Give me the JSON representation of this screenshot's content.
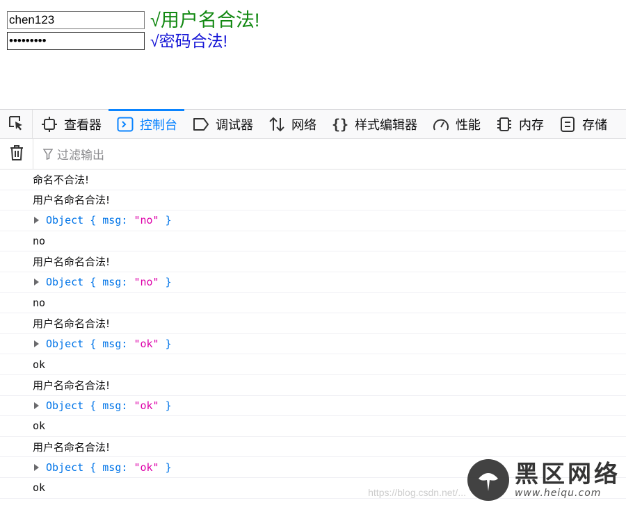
{
  "form": {
    "username_value": "chen123",
    "password_value": "•••••••••",
    "username_msg": "√用户名合法!",
    "password_msg": "√密码合法!",
    "username_msg_color": "#118811",
    "password_msg_color": "#1515d6"
  },
  "devtools": {
    "picker_icon": "element-picker-icon",
    "tabs": [
      {
        "label": "查看器",
        "icon": "inspector-icon"
      },
      {
        "label": "控制台",
        "icon": "console-icon",
        "selected": true
      },
      {
        "label": "调试器",
        "icon": "debugger-icon"
      },
      {
        "label": "网络",
        "icon": "network-icon"
      },
      {
        "label": "样式编辑器",
        "icon": "style-editor-icon"
      },
      {
        "label": "性能",
        "icon": "performance-icon"
      },
      {
        "label": "内存",
        "icon": "memory-icon"
      },
      {
        "label": "存储",
        "icon": "storage-icon"
      }
    ],
    "accent": "#0a84ff"
  },
  "console_toolbar": {
    "clear_icon": "trash-icon",
    "filter_placeholder": "过滤输出"
  },
  "console": {
    "rows": [
      {
        "kind": "text",
        "text": "命名不合法!"
      },
      {
        "kind": "text",
        "text": "用户名命名合法!"
      },
      {
        "kind": "object",
        "type": "Object",
        "key": "msg",
        "value": "\"no\""
      },
      {
        "kind": "text",
        "text": "no"
      },
      {
        "kind": "text",
        "text": "用户名命名合法!"
      },
      {
        "kind": "object",
        "type": "Object",
        "key": "msg",
        "value": "\"no\""
      },
      {
        "kind": "text",
        "text": "no"
      },
      {
        "kind": "text",
        "text": "用户名命名合法!"
      },
      {
        "kind": "object",
        "type": "Object",
        "key": "msg",
        "value": "\"ok\""
      },
      {
        "kind": "text",
        "text": "ok"
      },
      {
        "kind": "text",
        "text": "用户名命名合法!"
      },
      {
        "kind": "object",
        "type": "Object",
        "key": "msg",
        "value": "\"ok\""
      },
      {
        "kind": "text",
        "text": "ok"
      },
      {
        "kind": "text",
        "text": "用户名命名合法!"
      },
      {
        "kind": "object",
        "type": "Object",
        "key": "msg",
        "value": "\"ok\""
      },
      {
        "kind": "text",
        "text": "ok"
      }
    ]
  },
  "watermark": {
    "brand": "黑区网络",
    "url": "www.heiqu.com",
    "faint_url": "https://blog.csdn.net/..."
  }
}
